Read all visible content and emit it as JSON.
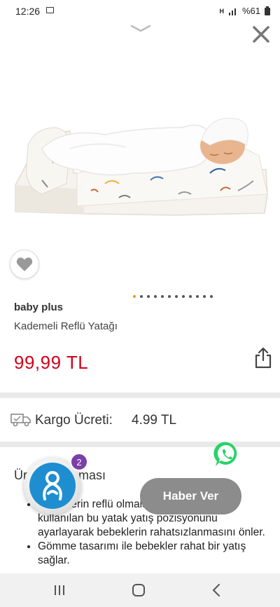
{
  "status_bar": {
    "time": "12:26",
    "signal": "H",
    "battery": "%61"
  },
  "product": {
    "brand": "baby plus",
    "name": "Kademeli Reflü Yatağı",
    "price": "99,99 TL",
    "image_dots": 12,
    "active_dot": 0
  },
  "shipping": {
    "label": "Kargo Ücreti:",
    "value": "4.99 TL"
  },
  "description": {
    "title": "Ürün Açıklaması",
    "items": [
      "Bebeklerin reflü olmalarını önlemek için kullanılan bu yatak yatış pozisyonunu ayarlayarak bebeklerin rahatsızlanmasını önler.",
      "Gömme tasarımı ile bebekler rahat bir yatış sağlar."
    ]
  },
  "actions": {
    "notify_label": "Haber Ver"
  },
  "chat": {
    "badge_count": "2"
  },
  "colors": {
    "price": "#d0021b",
    "active_dot": "#f29b00",
    "whatsapp": "#25d366",
    "chat": "#1e8ed0",
    "badge": "#7b3fa8"
  },
  "icons": [
    "chevron-down-icon",
    "close-icon",
    "heart-icon",
    "share-icon",
    "truck-icon",
    "whatsapp-icon",
    "chat-icon",
    "recents-icon",
    "home-icon",
    "back-icon"
  ]
}
